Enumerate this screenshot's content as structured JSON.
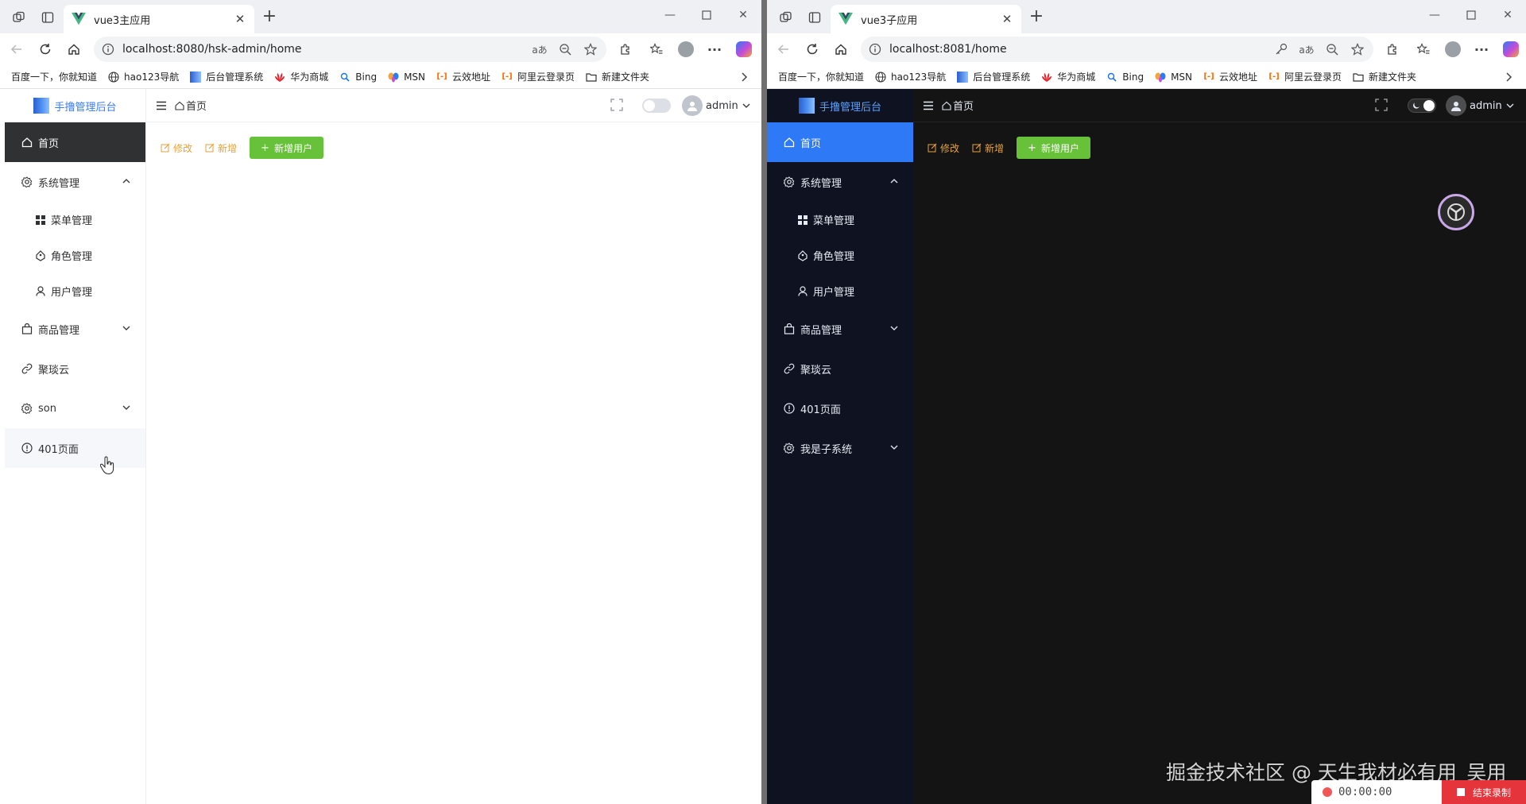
{
  "left": {
    "tab_title": "vue3主应用",
    "url": "localhost:8080/hsk-admin/home",
    "app": {
      "logo_text": "手撸管理后台",
      "breadcrumb": "首页",
      "username": "admin",
      "menu": {
        "home": "首页",
        "system": "系统管理",
        "sub": [
          "菜单管理",
          "角色管理",
          "用户管理"
        ],
        "goods": "商品管理",
        "jushuitan": "聚琰云",
        "son": "son",
        "p401": "401页面"
      },
      "toolbar": {
        "edit": "修改",
        "add": "新增",
        "add_user": "新增用户"
      }
    }
  },
  "right": {
    "tab_title": "vue3子应用",
    "url": "localhost:8081/home",
    "app": {
      "logo_text": "手撸管理后台",
      "breadcrumb": "首页",
      "username": "admin",
      "menu": {
        "home": "首页",
        "system": "系统管理",
        "sub": [
          "菜单管理",
          "角色管理",
          "用户管理"
        ],
        "goods": "商品管理",
        "jushuitan": "聚琰云",
        "p401": "401页面",
        "subsystem": "我是子系统"
      },
      "toolbar": {
        "edit": "修改",
        "add": "新增",
        "add_user": "新增用户"
      }
    }
  },
  "bookmarks": [
    "百度一下，你就知道",
    "hao123导航",
    "后台管理系统",
    "华为商城",
    "Bing",
    "MSN",
    "云效地址",
    "阿里云登录页",
    "新建文件夹"
  ],
  "watermark": "掘金技术社区 @ 天生我材必有用_吴用",
  "recorder": {
    "time": "00:00:00",
    "stop_label": "结束录制"
  },
  "colors": {
    "accent_blue": "#2d79f6",
    "success_green": "#67c23a",
    "warning_orange": "#e6a23c",
    "dark_sidebar": "#0f1321"
  }
}
